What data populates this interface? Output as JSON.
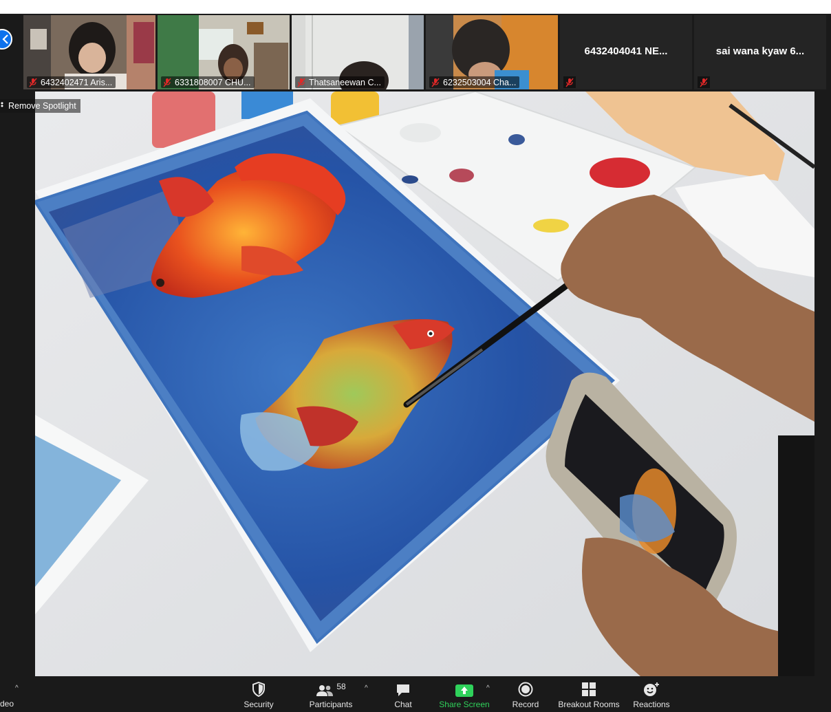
{
  "window": {
    "title": ""
  },
  "gallery": {
    "collapse_icon": "chevron-left-icon",
    "participants": [
      {
        "name": "6432402471 Aris...",
        "muted": true,
        "video": true
      },
      {
        "name": "6331808007 CHU...",
        "muted": true,
        "video": true
      },
      {
        "name": "Thatsaneewan C...",
        "muted": true,
        "video": true
      },
      {
        "name": "6232503004 Cha...",
        "muted": true,
        "video": true
      },
      {
        "name": "6432404041 NE...",
        "muted": true,
        "video": false
      },
      {
        "name": "sai wana kyaw 6...",
        "muted": true,
        "video": false
      }
    ]
  },
  "spotlight": {
    "label": "Remove Spotlight"
  },
  "toolbar": {
    "left_edge_label": "deo",
    "security": "Security",
    "participants": "Participants",
    "participants_count": "58",
    "chat": "Chat",
    "share_screen": "Share Screen",
    "record": "Record",
    "breakout_rooms": "Breakout Rooms",
    "reactions": "Reactions",
    "colors": {
      "share_green": "#2fd25b",
      "accent_blue": "#0e72ed",
      "muted_red": "#e02828"
    }
  }
}
